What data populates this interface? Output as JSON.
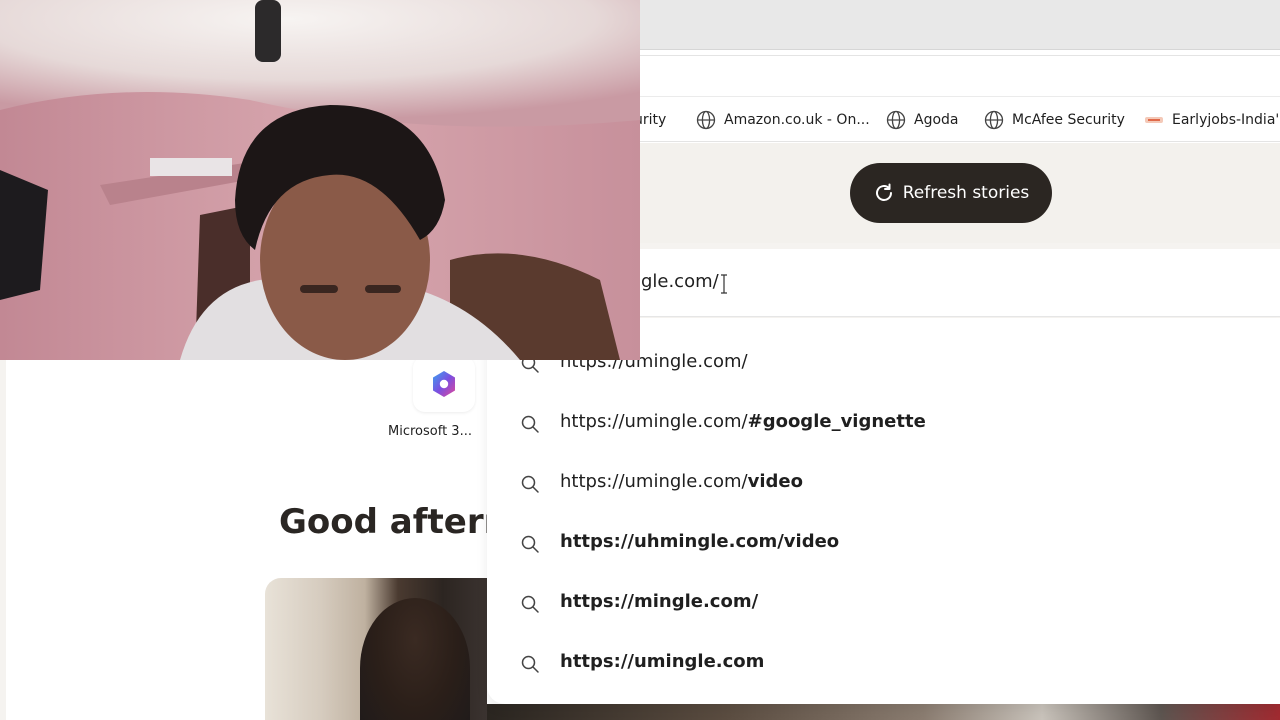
{
  "bookmarks": [
    {
      "label": "urity",
      "icon": "globe-icon"
    },
    {
      "label": "Amazon.co.uk - On...",
      "icon": "globe-icon"
    },
    {
      "label": "Agoda",
      "icon": "globe-icon"
    },
    {
      "label": "McAfee Security",
      "icon": "globe-icon"
    },
    {
      "label": "Earlyjobs-India's",
      "icon": "site-favicon"
    }
  ],
  "stories": {
    "refresh_label": "Refresh stories"
  },
  "search": {
    "query": "mingle.com/",
    "suggestions": [
      {
        "plain": "https://umingle.com/",
        "bold": ""
      },
      {
        "plain": "https://umingle.com/",
        "bold": "#google_vignette"
      },
      {
        "plain": "https://umingle.com/",
        "bold": "video"
      },
      {
        "plain": "",
        "bold": "https://uhmingle.com/video"
      },
      {
        "plain": "",
        "bold": "https://mingle.com/"
      },
      {
        "plain": "",
        "bold": "https://umingle.com"
      }
    ]
  },
  "tiles": [
    {
      "label": "Microsoft 3...",
      "icon": "microsoft-365-icon"
    }
  ],
  "greeting": "Good afterno",
  "colors": {
    "refresh_button": "#2b2622",
    "page_background": "#f5f3f0",
    "greeting_text": "#2a2623"
  }
}
